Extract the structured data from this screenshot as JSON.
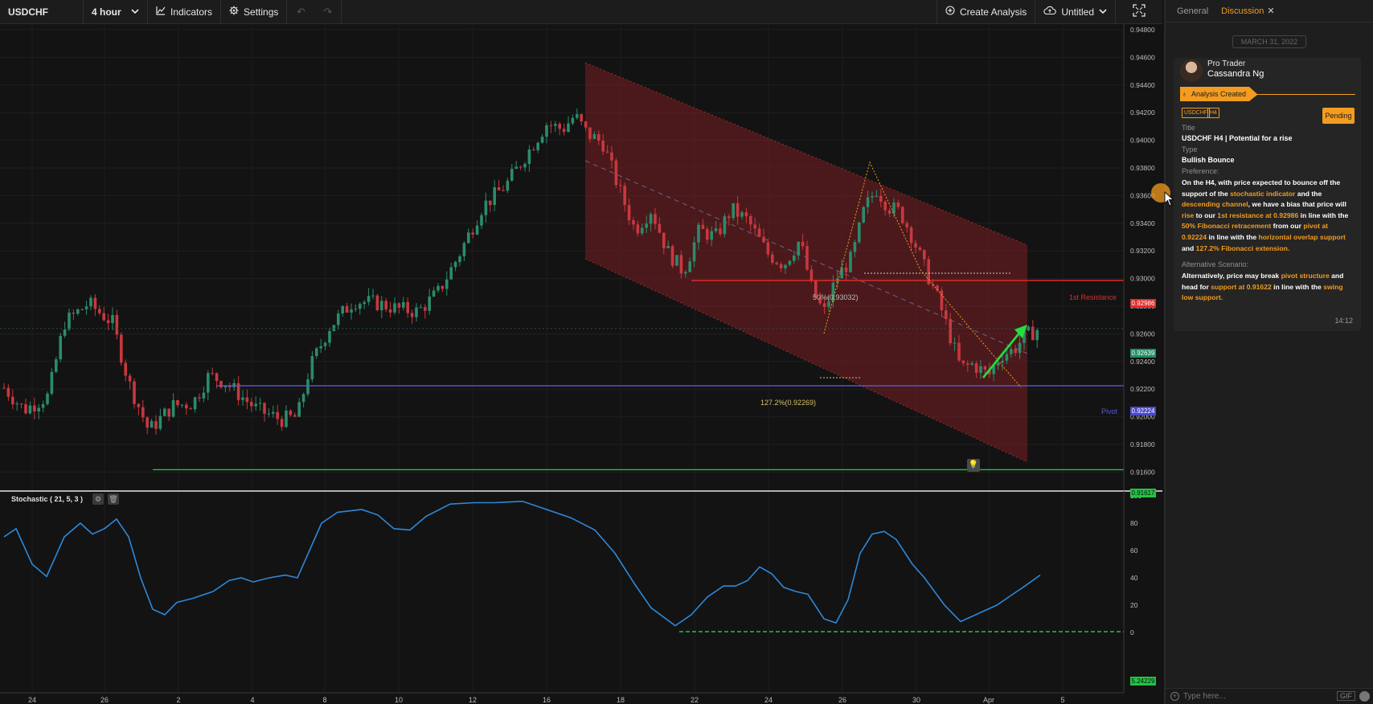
{
  "toolbar": {
    "symbol": "USDCHF",
    "interval": "4 hour",
    "indicators_label": "Indicators",
    "settings_label": "Settings",
    "create_analysis_label": "Create Analysis",
    "layout_name": "Untitled"
  },
  "colors": {
    "background": "#131313",
    "bull": "#2a8c6b",
    "bear": "#c8383f",
    "channel": "#7a1f22",
    "resistance": "#e02b2b",
    "pivot": "#5a5ad6",
    "support": "#21c443",
    "accent": "#f39c1f",
    "stoch": "#2e88d8"
  },
  "chart": {
    "price_axis": [
      "0.94800",
      "0.94600",
      "0.94400",
      "0.94200",
      "0.94000",
      "0.93800",
      "0.93600",
      "0.93400",
      "0.93200",
      "0.93000",
      "0.92800",
      "0.92600",
      "0.92400",
      "0.92200",
      "0.92000",
      "0.91800",
      "0.91600"
    ],
    "date_axis": [
      "24",
      "26",
      "2",
      "4",
      "8",
      "10",
      "12",
      "16",
      "18",
      "22",
      "24",
      "26",
      "30",
      "Apr",
      "5"
    ],
    "resistance_label": "1st Resistance",
    "resistance_value": "0.92986",
    "pivot_label": "Pivot",
    "pivot_value": "0.92224",
    "current_value": "0.92639",
    "support_value": "0.91617",
    "fib50_label": "50%(0.93032)",
    "fib127_label": "127.2%(0.92269)",
    "stoch_title": "Stochastic ( 21, 5, 3 )",
    "stoch_axis": [
      "100",
      "80",
      "60",
      "40",
      "20",
      "0"
    ],
    "stoch_value": "5.24229"
  },
  "panel": {
    "tab_general": "General",
    "tab_discussion": "Discussion",
    "tab_close": "✕",
    "date_chip": "MARCH 31, 2022",
    "role": "Pro Trader",
    "author": "Cassandra Ng",
    "status": "Analysis Created",
    "tag_symbol": "USDCHF",
    "tag_tf": "H4",
    "pending": "Pending",
    "title_label": "Title",
    "title_value": "USDCHF H4 | Potential for a rise",
    "type_label": "Type",
    "type_value": "Bullish Bounce",
    "pref_label": "Preference:",
    "pref_text": {
      "p1": "On the H4, with price expected to bounce off the support of the ",
      "h1": "stochastic indicator",
      "p2": " and the ",
      "h2": "descending channel",
      "p3": ", we have a bias that price will ",
      "h3": "rise",
      "p4": " to our ",
      "h4": "1st resistance at 0.92986",
      "p5": " in line with the ",
      "h5": "50% Fibonacci retracement",
      "p6": " from our ",
      "h6": "pivot at 0.92224",
      "p7": " in line with the ",
      "h7": "horizontal overlap support",
      "p8": " and ",
      "h8": "127.2% Fibonacci extension.",
      "p9": ""
    },
    "alt_label": "Alternative Scenario:",
    "alt_text": {
      "p1": "Alternatively, price may break ",
      "h1": "pivot structure",
      "p2": " and head for ",
      "h2": "support at 0.91622",
      "p3": "  in line with the ",
      "h3": "swing low support."
    },
    "time": "14:12",
    "composer_placeholder": "Type here...",
    "gif_label": "GIF"
  }
}
